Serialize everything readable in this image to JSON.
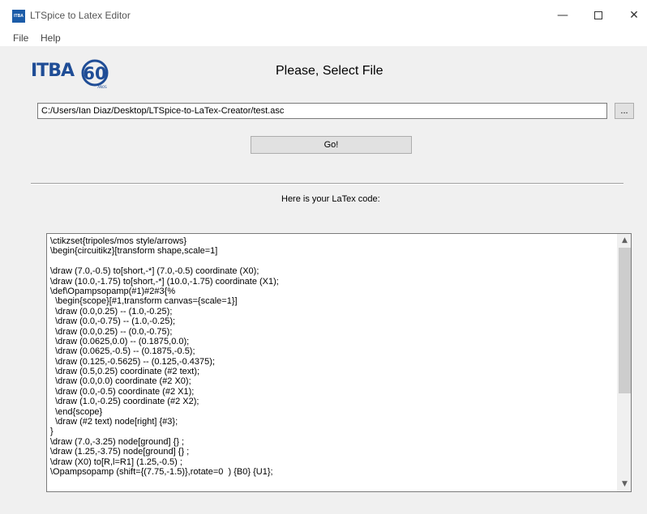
{
  "window": {
    "title": "LTSpice to Latex Editor",
    "icon_text": "ITBA",
    "minimize": "—",
    "close": "✕"
  },
  "menu": {
    "items": [
      "File",
      "Help"
    ]
  },
  "logo": {
    "text": "ITBA",
    "badge": "60",
    "sub": "AÑOS"
  },
  "main": {
    "title": "Please, Select File",
    "file_path": "C:/Users/Ian Diaz/Desktop/LTSpice-to-LaTex-Creator/test.asc",
    "browse_label": "...",
    "go_label": "Go!",
    "code_label": "Here is your LaTex code:"
  },
  "code": {
    "lines": [
      "\\ctikzset{tripoles/mos style/arrows}",
      "\\begin{circuitikz}[transform shape,scale=1]",
      "",
      "\\draw (7.0,-0.5) to[short,-*] (7.0,-0.5) coordinate (X0);",
      "\\draw (10.0,-1.75) to[short,-*] (10.0,-1.75) coordinate (X1);",
      "\\def\\Opampsopamp(#1)#2#3{%",
      "  \\begin{scope}[#1,transform canvas={scale=1}]",
      "  \\draw (0.0,0.25) -- (1.0,-0.25);",
      "  \\draw (0.0,-0.75) -- (1.0,-0.25);",
      "  \\draw (0.0,0.25) -- (0.0,-0.75);",
      "  \\draw (0.0625,0.0) -- (0.1875,0.0);",
      "  \\draw (0.0625,-0.5) -- (0.1875,-0.5);",
      "  \\draw (0.125,-0.5625) -- (0.125,-0.4375);",
      "  \\draw (0.5,0.25) coordinate (#2 text);",
      "  \\draw (0.0,0.0) coordinate (#2 X0);",
      "  \\draw (0.0,-0.5) coordinate (#2 X1);",
      "  \\draw (1.0,-0.25) coordinate (#2 X2);",
      "  \\end{scope}",
      "  \\draw (#2 text) node[right] {#3};",
      "}",
      "\\draw (7.0,-3.25) node[ground] {} ;",
      "\\draw (1.25,-3.75) node[ground] {} ;",
      "\\draw (X0) to[R,l=R1] (1.25,-0.5) ;",
      "\\Opampsopamp (shift={(7.75,-1.5)},rotate=0  ) {B0} {U1};"
    ]
  },
  "scrollbar": {
    "up": "▲",
    "down": "▼"
  },
  "colors": {
    "logo_blue": "#1f4d96",
    "window_bg": "#f0f0f0"
  }
}
